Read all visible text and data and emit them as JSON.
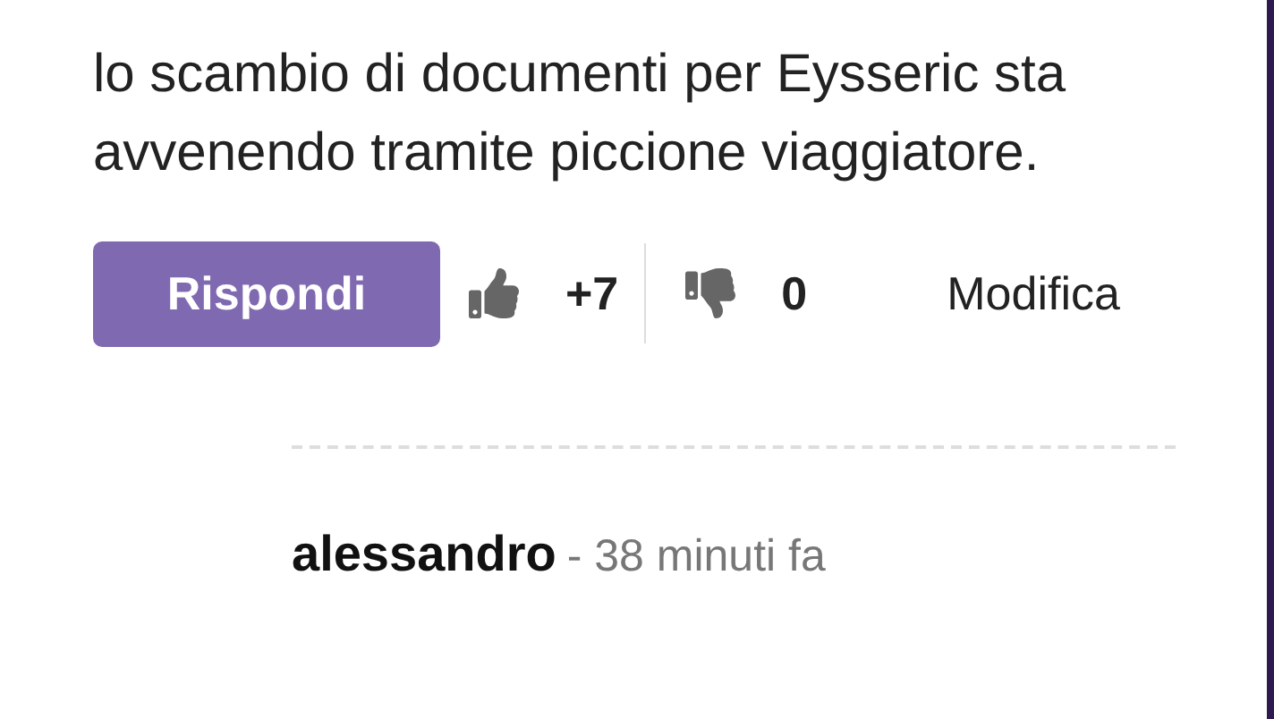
{
  "comment": {
    "text": "lo scambio di documenti per Eysseric sta avvenendo tramite piccione viaggiatore.",
    "reply_button": "Rispondi",
    "upvotes": "+7",
    "downvotes": "0",
    "edit_link": "Modifica"
  },
  "reply": {
    "author": "alessandro",
    "time": "- 38 minuti fa"
  }
}
